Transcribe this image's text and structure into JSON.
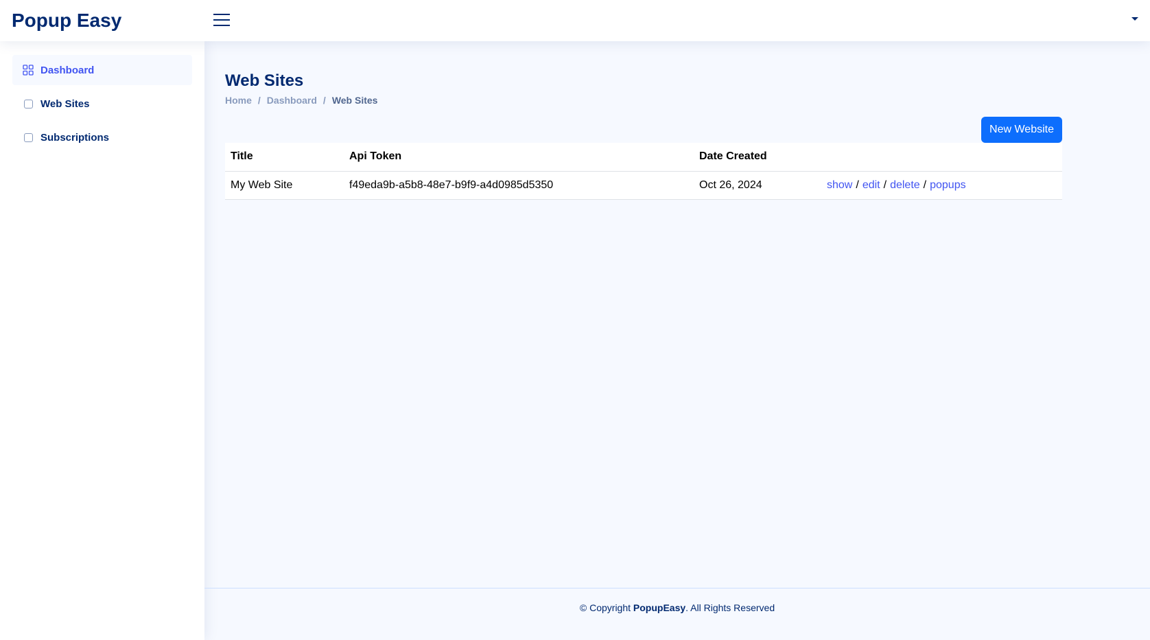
{
  "header": {
    "logo": "Popup Easy",
    "icons": {
      "menu": "hamburger-icon",
      "profile": "caret-down-icon"
    }
  },
  "sidebar": {
    "items": [
      {
        "label": "Dashboard",
        "icon": "grid-icon",
        "active": true
      },
      {
        "label": "Web Sites",
        "icon": "square-icon",
        "active": false
      },
      {
        "label": "Subscriptions",
        "icon": "square-icon",
        "active": false
      }
    ]
  },
  "page": {
    "title": "Web Sites",
    "breadcrumb": [
      "Home",
      "Dashboard",
      "Web Sites"
    ],
    "breadcrumb_sep": "/",
    "new_button": "New Website"
  },
  "table": {
    "headers": [
      "Title",
      "Api Token",
      "Date Created",
      ""
    ],
    "rows": [
      {
        "title": "My Web Site",
        "token": "f49eda9b-a5b8-48e7-b9f9-a4d0985d5350",
        "date": "Oct 26, 2024",
        "actions": [
          "show",
          "edit",
          "delete",
          "popups"
        ]
      }
    ],
    "action_sep": "/"
  },
  "footer": {
    "prefix": "© Copyright ",
    "brand": "PopupEasy",
    "suffix": ". All Rights Reserved"
  },
  "colors": {
    "brand": "#012970",
    "accent": "#4154f1",
    "button": "#0d6efd",
    "background": "#f6f9ff"
  }
}
